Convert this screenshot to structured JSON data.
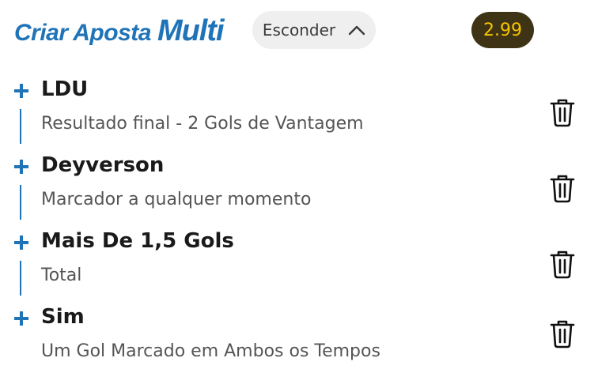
{
  "header": {
    "brand_text": "Criar Aposta",
    "brand_multi": "Multi",
    "hide_label": "Esconder",
    "odds": "2.99",
    "accent_color": "#1f73b7",
    "odds_bg": "#3f3316",
    "odds_fg": "#f5c400"
  },
  "selections": [
    {
      "title": "LDU",
      "subtitle": "Resultado final - 2 Gols de Vantagem"
    },
    {
      "title": "Deyverson",
      "subtitle": "Marcador a qualquer momento"
    },
    {
      "title": "Mais De 1,5 Gols",
      "subtitle": "Total"
    },
    {
      "title": "Sim",
      "subtitle": "Um Gol Marcado em Ambos os Tempos"
    }
  ],
  "icons": {
    "add": "plus-icon",
    "remove": "trash-icon",
    "collapse": "chevron-up-icon"
  }
}
